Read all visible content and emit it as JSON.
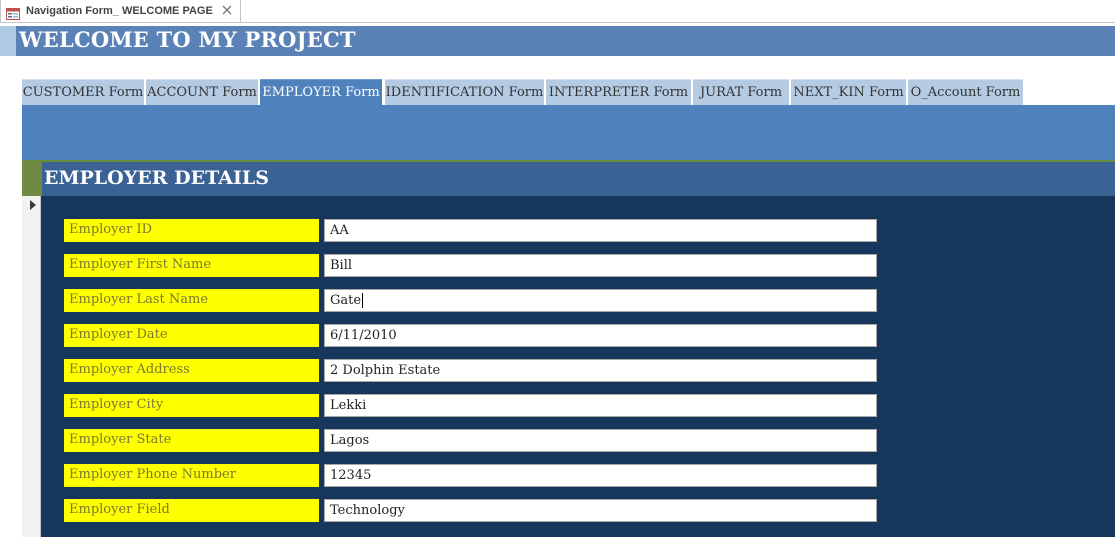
{
  "document_tab": {
    "title": "Navigation Form_ WELCOME PAGE",
    "icon": "form-icon",
    "close_icon": "close-icon"
  },
  "header": {
    "title": "WELCOME TO MY PROJECT"
  },
  "nav_tabs": [
    {
      "label": "CUSTOMER Form",
      "active": false
    },
    {
      "label": "ACCOUNT Form",
      "active": false
    },
    {
      "label": "EMPLOYER Form",
      "active": true
    },
    {
      "label": "IDENTIFICATION Form",
      "active": false
    },
    {
      "label": "INTERPRETER Form",
      "active": false
    },
    {
      "label": "JURAT Form",
      "active": false
    },
    {
      "label": "NEXT_KIN Form",
      "active": false
    },
    {
      "label": "O_Account Form",
      "active": false
    }
  ],
  "subform": {
    "title": "EMPLOYER DETAILS",
    "fields": [
      {
        "label": "Employer ID",
        "value": "AA"
      },
      {
        "label": "Employer First Name",
        "value": "Bill"
      },
      {
        "label": "Employer Last Name",
        "value": "Gate"
      },
      {
        "label": "Employer Date",
        "value": "6/11/2010"
      },
      {
        "label": "Employer Address",
        "value": "2 Dolphin Estate"
      },
      {
        "label": "Employer City",
        "value": "Lekki"
      },
      {
        "label": "Employer State",
        "value": "Lagos"
      },
      {
        "label": "Employer Phone Number",
        "value": "12345"
      },
      {
        "label": "Employer Field",
        "value": "Technology"
      }
    ]
  },
  "colors": {
    "header": "#5b82b7",
    "tab_inactive": "#b5cbe3",
    "tab_active": "#4f82bd",
    "subform_background": "#16365c",
    "label_background": "#ffff00"
  }
}
